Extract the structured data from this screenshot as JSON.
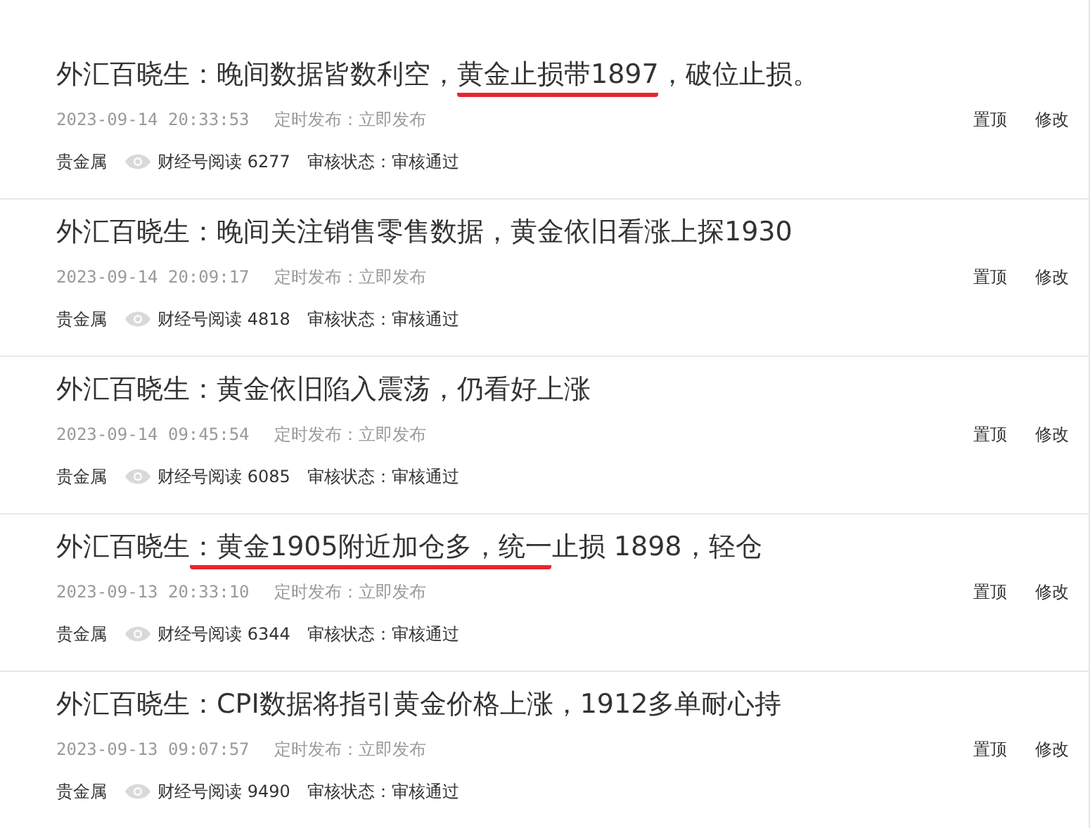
{
  "articles": [
    {
      "title": [
        {
          "text": "外汇百晓生：晚间数据皆数利空，",
          "marked": false
        },
        {
          "text": "黄金止损带1897",
          "marked": true
        },
        {
          "text": "，破位止损。",
          "marked": false
        }
      ],
      "time": "2023-09-14 20:33:53",
      "publish": "定时发布：立即发布",
      "actions": [
        "置顶",
        "修改"
      ],
      "category": "贵金属",
      "reads": "财经号阅读 6277",
      "review": "审核状态：审核通过"
    },
    {
      "title": [
        {
          "text": "外汇百晓生：晚间关注销售零售数据，黄金依旧看涨上探1930",
          "marked": false
        }
      ],
      "time": "2023-09-14 20:09:17",
      "publish": "定时发布：立即发布",
      "actions": [
        "置顶",
        "修改"
      ],
      "category": "贵金属",
      "reads": "财经号阅读 4818",
      "review": "审核状态：审核通过"
    },
    {
      "title": [
        {
          "text": "外汇百晓生：黄金依旧陷入震荡，仍看好上涨",
          "marked": false
        }
      ],
      "time": "2023-09-14 09:45:54",
      "publish": "定时发布：立即发布",
      "actions": [
        "置顶",
        "修改"
      ],
      "category": "贵金属",
      "reads": "财经号阅读 6085",
      "review": "审核状态：审核通过"
    },
    {
      "title": [
        {
          "text": "外汇百晓生",
          "marked": false
        },
        {
          "text": "：黄金1905附近加仓多，统一",
          "marked": true
        },
        {
          "text": "止损 1898，轻仓",
          "marked": false
        }
      ],
      "time": "2023-09-13 20:33:10",
      "publish": "定时发布：立即发布",
      "actions": [
        "置顶",
        "修改"
      ],
      "category": "贵金属",
      "reads": "财经号阅读 6344",
      "review": "审核状态：审核通过"
    },
    {
      "title": [
        {
          "text": "外汇百晓生：CPI数据将指引黄金价格上涨，1912多单耐心持",
          "marked": false
        }
      ],
      "time": "2023-09-13 09:07:57",
      "publish": "定时发布：立即发布",
      "actions": [
        "置顶",
        "修改"
      ],
      "category": "贵金属",
      "reads": "财经号阅读 9490",
      "review": "审核状态：审核通过"
    }
  ]
}
